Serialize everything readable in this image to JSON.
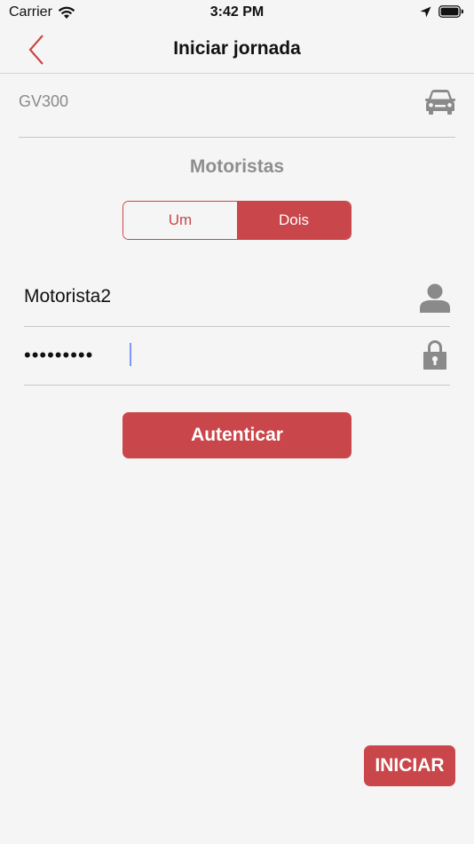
{
  "status_bar": {
    "carrier": "Carrier",
    "time": "3:42 PM"
  },
  "nav": {
    "title": "Iniciar jornada"
  },
  "vehicle": {
    "code": "GV300"
  },
  "drivers": {
    "title": "Motoristas",
    "segments": [
      "Um",
      "Dois"
    ],
    "selected": "Dois"
  },
  "form": {
    "username": "Motorista2",
    "password": "•••••••••"
  },
  "buttons": {
    "authenticate": "Autenticar",
    "start": "INICIAR"
  },
  "colors": {
    "accent": "#c9474a",
    "background": "#f5f5f5",
    "icon_gray": "#8a8a8a"
  },
  "icons": {
    "back": "chevron-left-icon",
    "vehicle": "car-icon",
    "user": "user-icon",
    "lock": "lock-icon",
    "wifi": "wifi-icon",
    "location": "location-arrow-icon",
    "battery": "battery-icon"
  }
}
